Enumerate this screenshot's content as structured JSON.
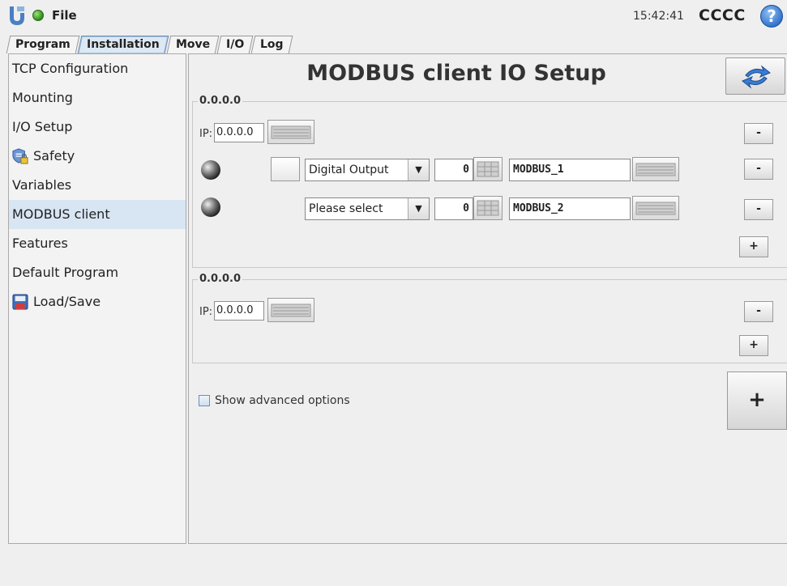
{
  "app": {
    "file_menu": "File",
    "clock": "15:42:41",
    "robot_name": "CCCC",
    "help": "?"
  },
  "tabs": [
    "Program",
    "Installation",
    "Move",
    "I/O",
    "Log"
  ],
  "sidebar": {
    "items": [
      {
        "label": "TCP Configuration"
      },
      {
        "label": "Mounting"
      },
      {
        "label": "I/O Setup"
      },
      {
        "label": "Safety"
      },
      {
        "label": "Variables"
      },
      {
        "label": "MODBUS client"
      },
      {
        "label": "Features"
      },
      {
        "label": "Default Program"
      },
      {
        "label": "Load/Save"
      }
    ],
    "selected": "MODBUS client"
  },
  "main": {
    "title": "MODBUS client IO Setup",
    "ip_label": "IP:",
    "groups": [
      {
        "label": "0.0.0.0",
        "ip": "0.0.0.0",
        "signals": [
          {
            "type": "Digital Output",
            "address": "0",
            "name": "MODBUS_1"
          },
          {
            "type": "Please select",
            "address": "0",
            "name": "MODBUS_2"
          }
        ]
      },
      {
        "label": "0.0.0.0",
        "ip": "0.0.0.0",
        "signals": []
      }
    ],
    "minus": "-",
    "plus": "+",
    "advanced_label": "Show advanced options",
    "add_label": "+"
  },
  "colors": {
    "selected_bg": "#d8e5f3",
    "status_green": "#2c8a17",
    "help_blue": "#2e6fc7"
  }
}
